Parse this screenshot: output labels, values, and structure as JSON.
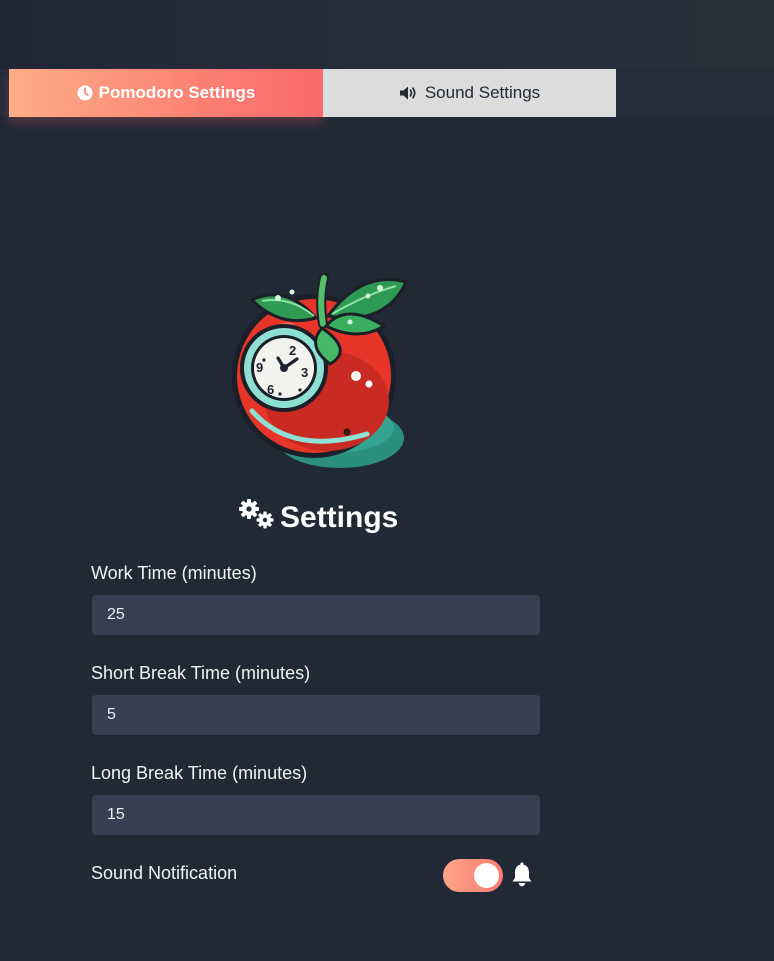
{
  "tabs": [
    {
      "label": "Pomodoro Settings",
      "icon": "clock-icon",
      "active": true
    },
    {
      "label": "Sound Settings",
      "icon": "volume-icon",
      "active": false
    }
  ],
  "logo": {
    "icon": "tomato-clock-icon",
    "clock_numbers": [
      "2",
      "9",
      "3",
      "6"
    ]
  },
  "settings": {
    "title": "Settings",
    "title_icon": "gears-icon",
    "fields": [
      {
        "label": "Work Time (minutes)",
        "value": "25"
      },
      {
        "label": "Short Break Time (minutes)",
        "value": "5"
      },
      {
        "label": "Long Break Time (minutes)",
        "value": "15"
      }
    ],
    "sound_notification": {
      "label": "Sound Notification",
      "enabled": true,
      "icon": "bell-icon"
    }
  },
  "colors": {
    "background": "#212836",
    "accent_start": "#fdae86",
    "accent_end": "#fa6a6c",
    "input_bg": "#374052",
    "inactive_tab": "#dcdcdc"
  }
}
